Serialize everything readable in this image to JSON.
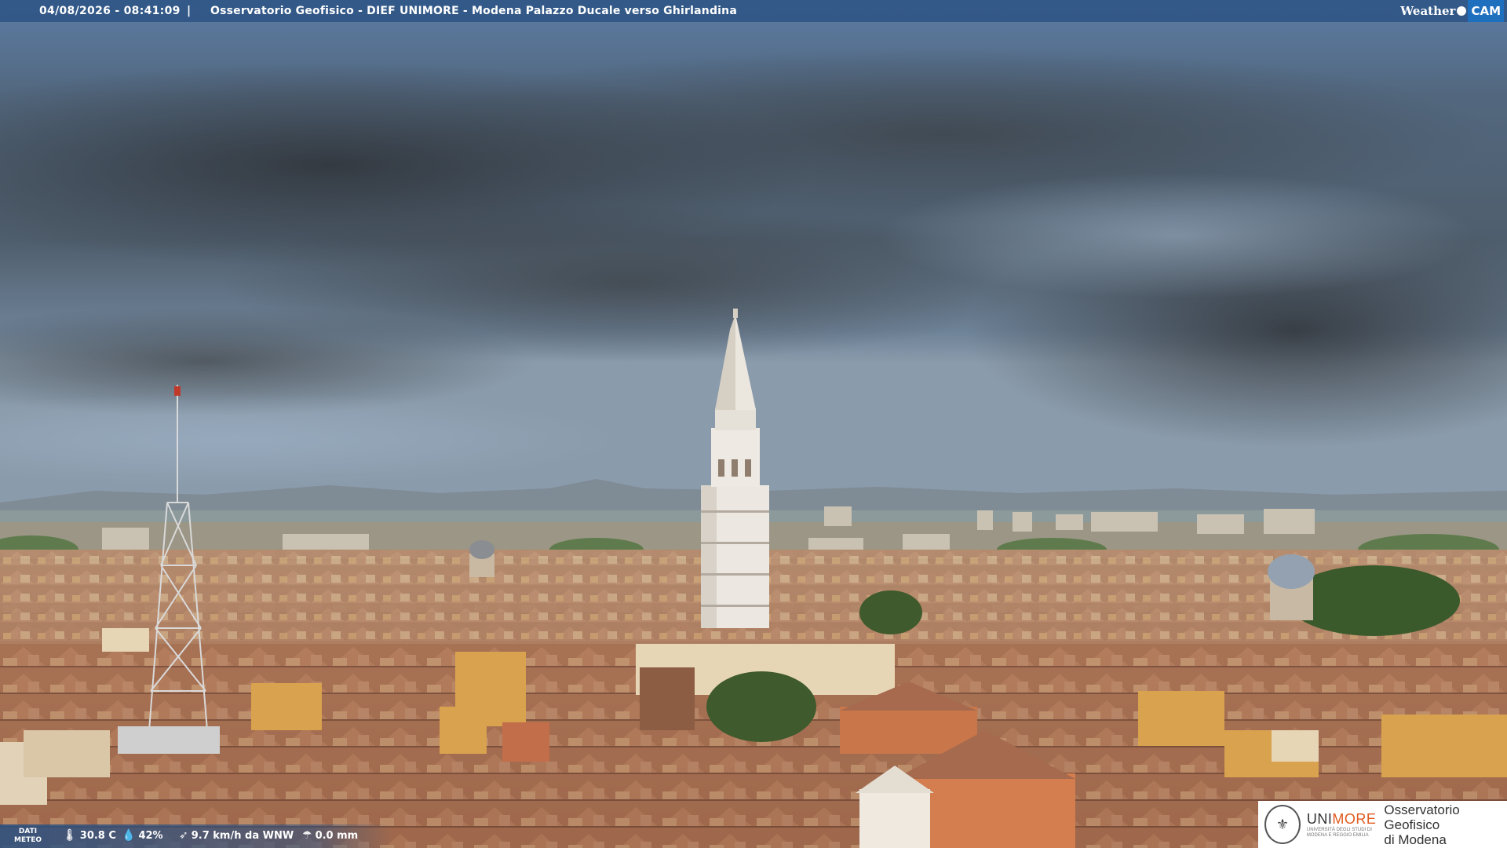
{
  "overlay": {
    "datetime": "04/08/2026 - 08:41:09",
    "separator": "|",
    "title": "Osservatorio Geofisico - DIEF UNIMORE - Modena Palazzo Ducale verso Ghirlandina",
    "logo_weather": "Weather",
    "logo_cam": "CAM"
  },
  "meteo": {
    "label_line1": "DATI",
    "label_line2": "METEO",
    "temperature": "30.8 C",
    "humidity": "42%",
    "wind": "9.7 km/h da WNW",
    "rain": "0.0 mm",
    "icons": [
      "thermometer-icon",
      "humidity-drop-icon",
      "wind-icon",
      "rain-icon"
    ]
  },
  "branding": {
    "uni_name_prefix": "UNI",
    "uni_name_suffix": "MORE",
    "uni_subtitle_line1": "UNIVERSITÀ DEGLI STUDI DI",
    "uni_subtitle_line2": "MODENA E REGGIO EMILIA",
    "observatory_line1": "Osservatorio Geofisico",
    "observatory_line2": "di Modena",
    "accent_color": "#e05a1e"
  }
}
